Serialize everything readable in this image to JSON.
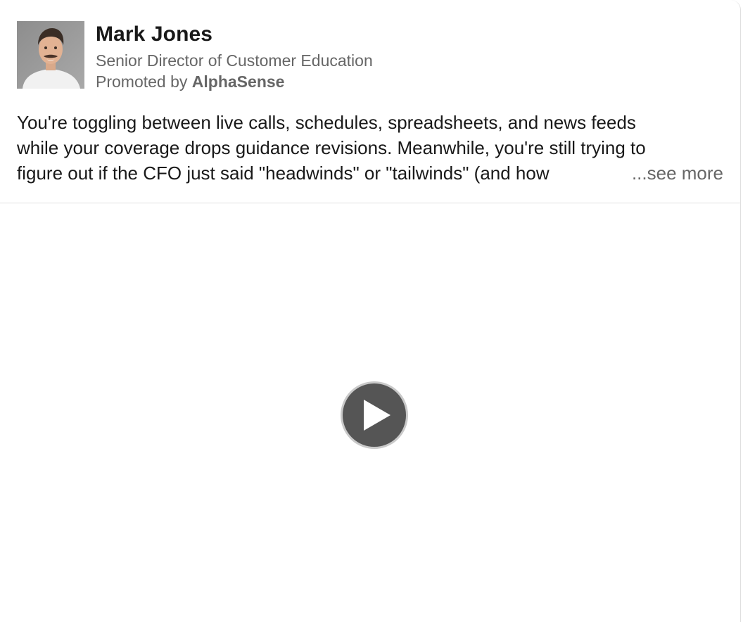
{
  "post": {
    "author": {
      "name": "Mark Jones",
      "title": "Senior Director of Customer Education",
      "promoted_prefix": "Promoted by ",
      "company": "AlphaSense"
    },
    "body": {
      "line1": "You're toggling between live calls, schedules, spreadsheets, and news feeds",
      "line2": "while your coverage drops guidance revisions. Meanwhile, you're still trying to",
      "line3": "figure out if the CFO just said \"headwinds\" or \"tailwinds\" (and how",
      "see_more": "...see more"
    },
    "media": {
      "play_icon": "play-icon"
    }
  },
  "colors": {
    "text_primary": "#191919",
    "text_secondary": "#666666",
    "divider": "#e0e0e0",
    "play_button_fill": "#555555"
  }
}
